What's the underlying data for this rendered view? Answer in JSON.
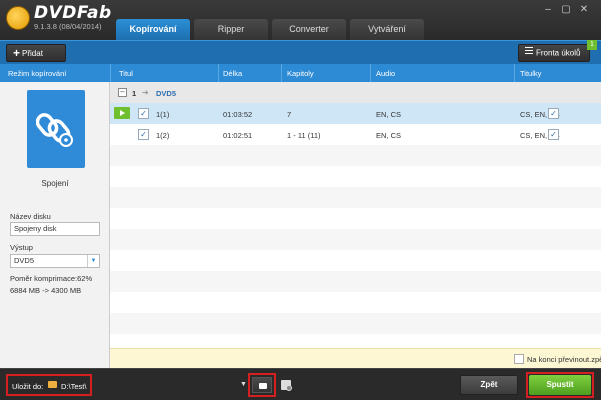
{
  "app": {
    "name": "DVDFab",
    "version": "9.1.3.8 (08/04/2014)"
  },
  "tabs": [
    {
      "label": "Kopírování",
      "active": true
    },
    {
      "label": "Ripper",
      "active": false
    },
    {
      "label": "Converter",
      "active": false
    },
    {
      "label": "Vytváření",
      "active": false
    }
  ],
  "window_controls": {
    "minimize": "–",
    "maximize": "▢",
    "close": "✕"
  },
  "toolbar": {
    "add_label": "Přidat",
    "queue_label": "Fronta úkolů",
    "queue_count": "1"
  },
  "columns": {
    "mode": "Režim kopírování",
    "title": "Titul",
    "length": "Délka",
    "chapters": "Kapitoly",
    "audio": "Audio",
    "subtitles": "Titulky"
  },
  "left_panel": {
    "mode_name": "Spojení",
    "disc_name_label": "Název disku",
    "disc_name_value": "Spojeny disk",
    "output_label": "Výstup",
    "output_value": "DVD5",
    "compression": "Poměr komprimace:62%",
    "size": "6884 MB -> 4300 MB"
  },
  "group": {
    "number": "1",
    "name": "DVD5"
  },
  "rows": [
    {
      "title": "1(1)",
      "length": "01:03:52",
      "chapters": "7",
      "audio": "EN, CS",
      "subtitles": "CS, EN, CS"
    },
    {
      "title": "1(2)",
      "length": "01:02:51",
      "chapters": "1 - 11 (11)",
      "audio": "EN, CS",
      "subtitles": "CS, EN, CS"
    }
  ],
  "notice": {
    "text": "Na konci převinout.zpět"
  },
  "footer": {
    "save_label": "Uložit do:",
    "path": "D:\\Test\\",
    "back_label": "Zpět",
    "start_label": "Spustit"
  },
  "colors": {
    "accent": "#2d8ad4",
    "start": "#5fae2a",
    "highlight": "#d42020"
  }
}
